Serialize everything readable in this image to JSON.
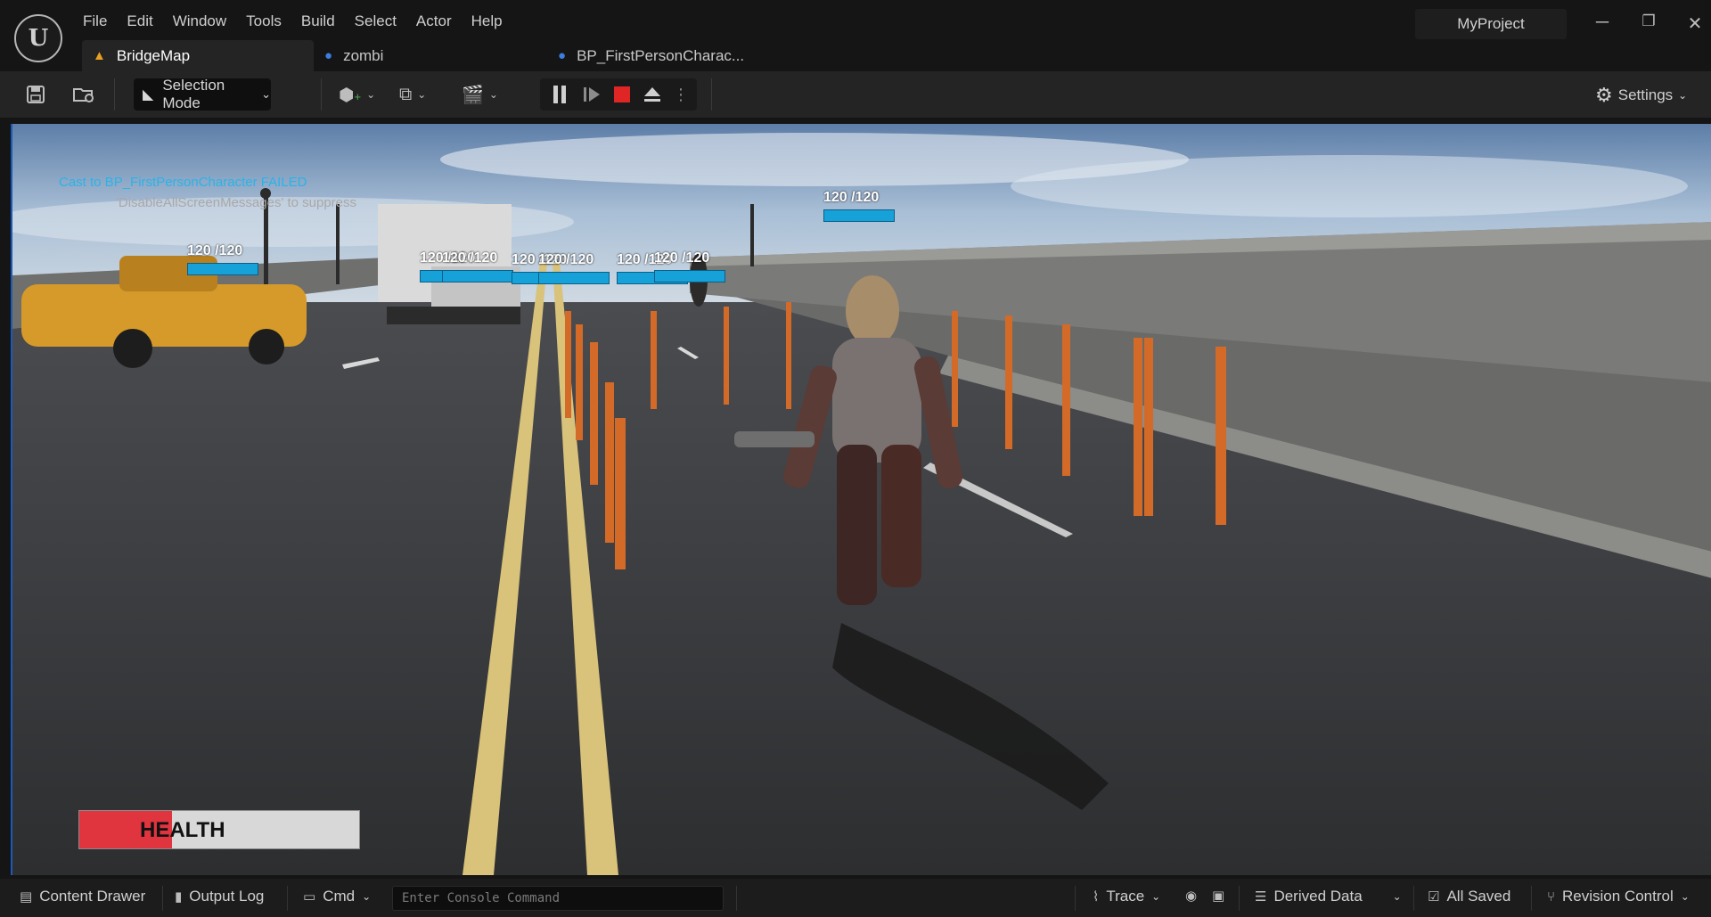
{
  "menu": [
    "File",
    "Edit",
    "Window",
    "Tools",
    "Build",
    "Select",
    "Actor",
    "Help"
  ],
  "tabs": [
    {
      "label": "BridgeMap",
      "icon": "level-icon"
    },
    {
      "label": "zombi",
      "icon": "blueprint-icon"
    },
    {
      "label": "BP_FirstPersonCharac...",
      "icon": "blueprint-icon"
    }
  ],
  "project": "MyProject",
  "window_controls": {
    "minimize": "─",
    "restore": "❐",
    "close": "✕"
  },
  "toolbar": {
    "selection_mode": "Selection Mode",
    "settings": "Settings"
  },
  "viewport": {
    "messages": {
      "error": "Cast to BP_FirstPersonCharacter FAILED",
      "hint": "'DisableAllScreenMessages' to suppress"
    },
    "enemy_health": [
      {
        "text": "120 /120",
        "fraction": 1.0
      },
      {
        "text": "120 /120",
        "fraction": 1.0
      },
      {
        "text": "120 /120",
        "fraction": 1.0
      },
      {
        "text": "120 /120",
        "fraction": 1.0
      },
      {
        "text": "120 /120",
        "fraction": 1.0
      },
      {
        "text": "120 /120",
        "fraction": 1.0
      },
      {
        "text": "120 /120",
        "fraction": 1.0
      },
      {
        "text": "120 /120",
        "fraction": 1.0
      }
    ],
    "player_health": {
      "label": "HEALTH",
      "fraction": 0.33,
      "fill_color": "#e0343f"
    }
  },
  "statusbar": {
    "content_drawer": "Content Drawer",
    "output_log": "Output Log",
    "cmd": "Cmd",
    "console_placeholder": "Enter Console Command",
    "trace": "Trace",
    "derived_data": "Derived Data",
    "all_saved": "All Saved",
    "revision_control": "Revision Control"
  },
  "colors": {
    "accent": "#16a1d8",
    "stop": "#e02525",
    "message": "#2bb3e8"
  }
}
